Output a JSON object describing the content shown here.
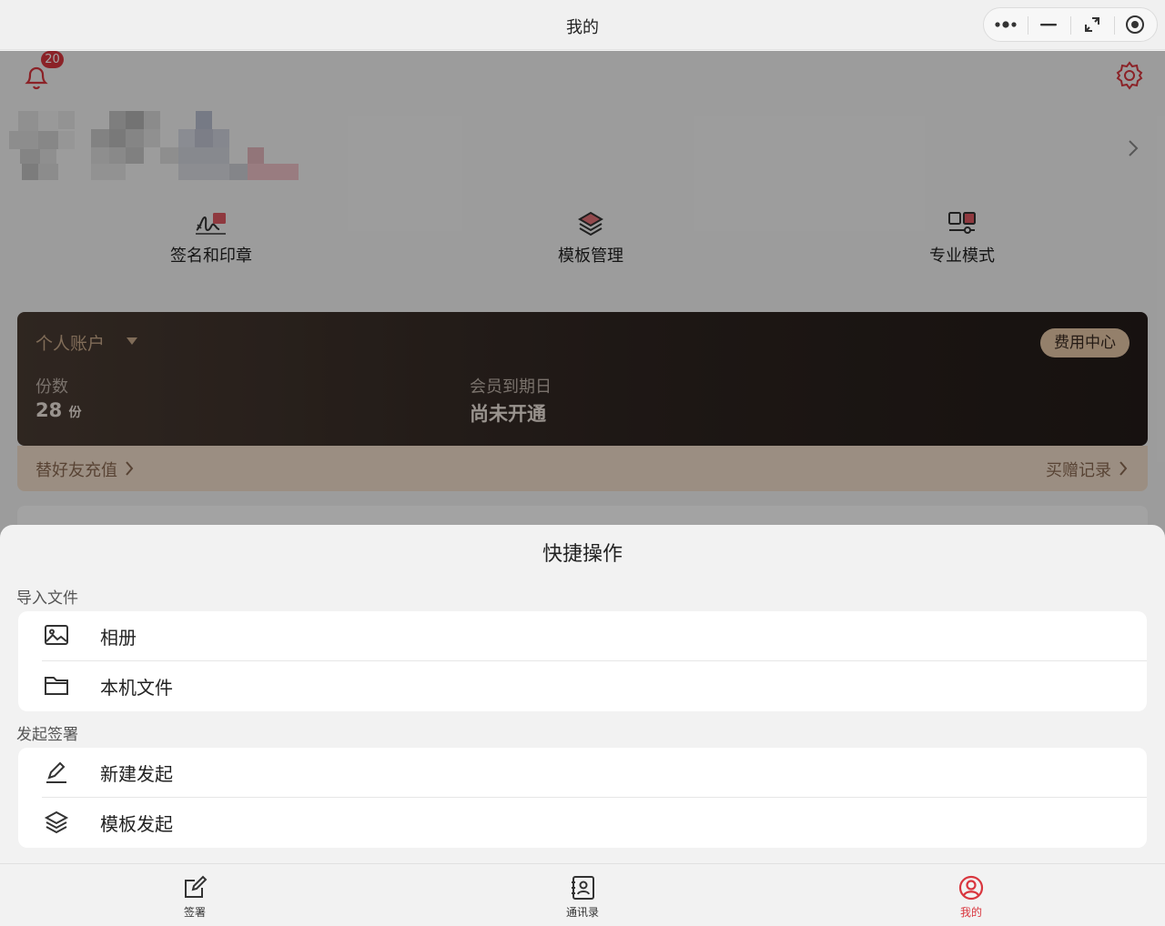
{
  "window": {
    "title": "我的"
  },
  "header": {
    "notification_count": "20"
  },
  "quick_actions": [
    {
      "label": "签名和印章",
      "icon": "signature-icon"
    },
    {
      "label": "模板管理",
      "icon": "layers-icon"
    },
    {
      "label": "专业模式",
      "icon": "pro-mode-icon"
    }
  ],
  "account": {
    "type_label": "个人账户",
    "fee_button": "费用中心",
    "copies_label": "份数",
    "copies_value": "28",
    "copies_unit": "份",
    "member_label": "会员到期日",
    "member_value": "尚未开通"
  },
  "promo": {
    "left": "替好友充值",
    "right": "买赠记录"
  },
  "sheet": {
    "title": "快捷操作",
    "sections": [
      {
        "title": "导入文件",
        "items": [
          {
            "label": "相册",
            "icon": "image-icon"
          },
          {
            "label": "本机文件",
            "icon": "folder-icon"
          }
        ]
      },
      {
        "title": "发起签署",
        "items": [
          {
            "label": "新建发起",
            "icon": "pen-icon"
          },
          {
            "label": "模板发起",
            "icon": "layers-icon"
          }
        ]
      }
    ]
  },
  "tabs": [
    {
      "label": "签署",
      "icon": "edit-icon",
      "active": false
    },
    {
      "label": "通讯录",
      "icon": "contacts-icon",
      "active": false
    },
    {
      "label": "我的",
      "icon": "user-circle-icon",
      "active": true
    }
  ],
  "colors": {
    "accent": "#d9363e",
    "card_dark": "#2f2521",
    "card_gold": "#e8c8a8"
  }
}
